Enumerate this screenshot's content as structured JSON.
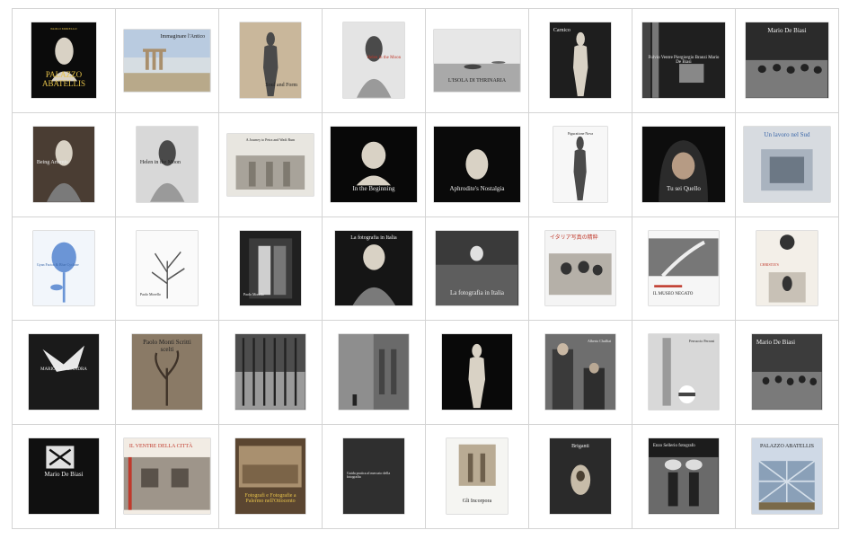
{
  "colors": {
    "grid_line": "#d4d4d4",
    "background": "#ffffff"
  },
  "books": [
    {
      "id": "b01",
      "title": "PALAZZO ABATELLIS",
      "subtitle": "PAOLO MORELLO",
      "bg": "#0b0b0b",
      "fg": "gold",
      "icon": "bust-sculpture-icon",
      "pos": "t-bot",
      "align": "center",
      "tsize": 9,
      "cover": [
        0.18,
        0.13,
        0.64,
        0.73
      ]
    },
    {
      "id": "b02",
      "title": "Immaginare l'Antico",
      "subtitle": "",
      "bg": "#d6dde2",
      "fg": "dark",
      "icon": "ruined-temple-icon",
      "pos": "t-top",
      "align": "right",
      "tsize": 6,
      "cover": [
        0.08,
        0.2,
        0.84,
        0.6
      ]
    },
    {
      "id": "b03",
      "title": "Soul and Form",
      "subtitle": "",
      "bg": "#c9b79b",
      "fg": "dark",
      "icon": "nude-figure-icon",
      "pos": "t-bot",
      "align": "right",
      "tsize": 6,
      "cover": [
        0.2,
        0.13,
        0.6,
        0.73
      ]
    },
    {
      "id": "b04",
      "title": "Helen in the Moon",
      "subtitle": "",
      "bg": "#e4e4e4",
      "fg": "red",
      "icon": "portrait-figure-icon",
      "pos": "t-mid",
      "align": "right",
      "tsize": 5,
      "cover": [
        0.2,
        0.13,
        0.6,
        0.73
      ]
    },
    {
      "id": "b05",
      "title": "L'ISOLA DI THRINARIA",
      "subtitle": "",
      "bg": "#cfcfcf",
      "fg": "dark",
      "icon": "island-seascape-icon",
      "pos": "t-bot",
      "align": "center",
      "tsize": 6,
      "cover": [
        0.08,
        0.2,
        0.84,
        0.6
      ]
    },
    {
      "id": "b06",
      "title": "Carnico",
      "subtitle": "",
      "bg": "#1e1e1e",
      "fg": "light",
      "icon": "nude-figure-icon",
      "pos": "t-top",
      "align": "left",
      "tsize": 6,
      "cover": [
        0.2,
        0.13,
        0.6,
        0.73
      ]
    },
    {
      "id": "b07",
      "title": "Fulvio Ventre Piergiorgio Branzi Mario De Biasi",
      "subtitle": "",
      "bg": "#1f1f1f",
      "fg": "light",
      "icon": "boxed-set-icon",
      "pos": "t-mid",
      "align": "center",
      "tsize": 5,
      "cover": [
        0.1,
        0.13,
        0.8,
        0.73
      ]
    },
    {
      "id": "b08",
      "title": "Mario De Biasi",
      "subtitle": "",
      "bg": "#2b2b2b",
      "fg": "light",
      "icon": "street-crowd-icon",
      "pos": "t-top",
      "align": "center",
      "tsize": 7,
      "cover": [
        0.1,
        0.13,
        0.8,
        0.73
      ]
    },
    {
      "id": "b09",
      "title": "Being Artemis",
      "subtitle": "",
      "bg": "#4a3d33",
      "fg": "light",
      "icon": "portrait-figure-icon",
      "pos": "t-mid",
      "align": "left",
      "tsize": 6,
      "cover": [
        0.2,
        0.13,
        0.6,
        0.73
      ]
    },
    {
      "id": "b10",
      "title": "Helen in the Moon",
      "subtitle": "",
      "bg": "#d8d8d8",
      "fg": "dark",
      "icon": "portrait-figure-icon",
      "pos": "t-mid",
      "align": "left",
      "tsize": 6,
      "cover": [
        0.2,
        0.13,
        0.6,
        0.73
      ]
    },
    {
      "id": "b11",
      "title": "A Journey to Petra and Wadi Rum",
      "subtitle": "",
      "bg": "#e8e6e0",
      "fg": "dark",
      "icon": "rock-temple-icon",
      "pos": "t-top",
      "align": "center",
      "tsize": 4,
      "cover": [
        0.08,
        0.2,
        0.84,
        0.6
      ]
    },
    {
      "id": "b12",
      "title": "In the Beginning",
      "subtitle": "",
      "bg": "#080808",
      "fg": "light",
      "icon": "bust-sculpture-icon",
      "pos": "t-bot",
      "align": "center",
      "tsize": 7,
      "cover": [
        0.08,
        0.13,
        0.84,
        0.73
      ]
    },
    {
      "id": "b13",
      "title": "Aphrodite's Nostalgia",
      "subtitle": "",
      "bg": "#0a0a0a",
      "fg": "light",
      "icon": "shell-figure-icon",
      "pos": "t-bot",
      "align": "center",
      "tsize": 7,
      "cover": [
        0.08,
        0.13,
        0.84,
        0.73
      ]
    },
    {
      "id": "b14",
      "title": "Figuratione Nova",
      "subtitle": "",
      "bg": "#f7f7f7",
      "fg": "dark",
      "icon": "nude-figure-icon",
      "pos": "t-top",
      "align": "center",
      "tsize": 4,
      "cover": [
        0.24,
        0.13,
        0.52,
        0.73
      ]
    },
    {
      "id": "b15",
      "title": "Tu sei Quello",
      "subtitle": "",
      "bg": "#0d0d0d",
      "fg": "light",
      "icon": "hooded-figure-icon",
      "pos": "t-bot",
      "align": "center",
      "tsize": 7,
      "cover": [
        0.1,
        0.13,
        0.8,
        0.73
      ]
    },
    {
      "id": "b16",
      "title": "Un lavoro nel Sud",
      "subtitle": "",
      "bg": "#d7dbe0",
      "fg": "blue",
      "icon": "building-icon",
      "pos": "t-top",
      "align": "center",
      "tsize": 7,
      "cover": [
        0.08,
        0.13,
        0.84,
        0.73
      ]
    },
    {
      "id": "b17",
      "title": "Gyan Factor & Blue Cyclone",
      "subtitle": "",
      "bg": "#f2f6fb",
      "fg": "blue",
      "icon": "flower-icon",
      "pos": "t-mid",
      "align": "left",
      "tsize": 4,
      "cover": [
        0.2,
        0.13,
        0.6,
        0.73
      ]
    },
    {
      "id": "b18",
      "title": "Paolo Morello",
      "subtitle": "",
      "bg": "#fafafa",
      "fg": "dark",
      "icon": "tree-sketch-icon",
      "pos": "t-bot",
      "align": "left",
      "tsize": 4,
      "cover": [
        0.2,
        0.13,
        0.6,
        0.73
      ]
    },
    {
      "id": "b19",
      "title": "Paolo Morello",
      "subtitle": "",
      "bg": "#202020",
      "fg": "light",
      "icon": "doorway-icon",
      "pos": "t-bot",
      "align": "left",
      "tsize": 4,
      "cover": [
        0.2,
        0.13,
        0.6,
        0.73
      ]
    },
    {
      "id": "b20",
      "title": "La fotografia in Italia",
      "subtitle": "",
      "bg": "#151515",
      "fg": "light",
      "icon": "portrait-figure-icon",
      "pos": "t-top",
      "align": "center",
      "tsize": 6,
      "cover": [
        0.12,
        0.13,
        0.76,
        0.73
      ]
    },
    {
      "id": "b21",
      "title": "La fotografia in Italia",
      "subtitle": "",
      "bg": "#3a3a3a",
      "fg": "light",
      "icon": "field-figure-icon",
      "pos": "t-bot",
      "align": "center",
      "tsize": 7,
      "cover": [
        0.1,
        0.13,
        0.8,
        0.73
      ]
    },
    {
      "id": "b22",
      "title": "イタリア写真の精粋",
      "subtitle": "",
      "bg": "#f4f4f4",
      "fg": "red",
      "icon": "group-photo-icon",
      "pos": "t-top",
      "align": "left",
      "tsize": 6,
      "cover": [
        0.16,
        0.13,
        0.68,
        0.73
      ]
    },
    {
      "id": "b23",
      "title": "IL MUSEO NEGATO",
      "subtitle": "",
      "bg": "#f6f6f6",
      "fg": "dark",
      "icon": "landscape-road-icon",
      "pos": "t-bot",
      "align": "left",
      "tsize": 5,
      "cover": [
        0.16,
        0.13,
        0.68,
        0.73
      ]
    },
    {
      "id": "b24",
      "title": "CHRISTIE'S",
      "subtitle": "",
      "bg": "#f3efe8",
      "fg": "red",
      "icon": "child-portrait-icon",
      "pos": "t-mid",
      "align": "left",
      "tsize": 4,
      "cover": [
        0.2,
        0.13,
        0.6,
        0.73
      ]
    },
    {
      "id": "b25",
      "title": "MARIO LASALANDRA",
      "subtitle": "",
      "bg": "#1a1a1a",
      "fg": "light",
      "icon": "glove-hand-icon",
      "pos": "t-mid",
      "align": "center",
      "tsize": 5,
      "cover": [
        0.16,
        0.13,
        0.68,
        0.73
      ]
    },
    {
      "id": "b26",
      "title": "Paolo Monti Scritti scelti",
      "subtitle": "",
      "bg": "#8a7a66",
      "fg": "dark",
      "icon": "leaf-plant-icon",
      "pos": "t-top",
      "align": "center",
      "tsize": 7,
      "cover": [
        0.16,
        0.13,
        0.68,
        0.73
      ]
    },
    {
      "id": "b27",
      "title": "",
      "subtitle": "",
      "bg": "#4d4d4d",
      "fg": "light",
      "icon": "forest-reflection-icon",
      "pos": "t-top",
      "align": "center",
      "tsize": 4,
      "cover": [
        0.16,
        0.13,
        0.68,
        0.73
      ]
    },
    {
      "id": "b28",
      "title": "",
      "subtitle": "",
      "bg": "#8e8e8e",
      "fg": "light",
      "icon": "street-arcade-icon",
      "pos": "t-top",
      "align": "center",
      "tsize": 4,
      "cover": [
        0.16,
        0.13,
        0.68,
        0.73
      ]
    },
    {
      "id": "b29",
      "title": "",
      "subtitle": "",
      "bg": "#090909",
      "fg": "light",
      "icon": "nude-figure-icon",
      "pos": "t-top",
      "align": "center",
      "tsize": 4,
      "cover": [
        0.16,
        0.13,
        0.68,
        0.73
      ]
    },
    {
      "id": "b30",
      "title": "Alberto Chulliat",
      "subtitle": "",
      "bg": "#6e6e6e",
      "fg": "light",
      "icon": "two-men-portrait-icon",
      "pos": "t-top",
      "align": "right",
      "tsize": 4,
      "cover": [
        0.16,
        0.13,
        0.68,
        0.73
      ]
    },
    {
      "id": "b31",
      "title": "Ferruccio Ferroni",
      "subtitle": "",
      "bg": "#cfcfcf",
      "fg": "dark",
      "icon": "beach-ball-icon",
      "pos": "t-top",
      "align": "right",
      "tsize": 4,
      "cover": [
        0.16,
        0.13,
        0.68,
        0.73
      ]
    },
    {
      "id": "b32",
      "title": "Mario De Biasi",
      "subtitle": "",
      "bg": "#3c3c3c",
      "fg": "light",
      "icon": "crowd-icon",
      "pos": "t-top",
      "align": "left",
      "tsize": 7,
      "cover": [
        0.16,
        0.13,
        0.68,
        0.73
      ]
    },
    {
      "id": "b33",
      "title": "Mario De Biasi",
      "subtitle": "",
      "bg": "#101010",
      "fg": "light",
      "icon": "window-light-icon",
      "pos": "t-mid",
      "align": "center",
      "tsize": 7,
      "cover": [
        0.16,
        0.13,
        0.68,
        0.73
      ]
    },
    {
      "id": "b34",
      "title": "IL VENTRE DELLA CITTÀ",
      "subtitle": "",
      "bg": "#f2ece4",
      "fg": "red",
      "icon": "old-street-icon",
      "pos": "t-top",
      "align": "left",
      "tsize": 6,
      "cover": [
        0.08,
        0.13,
        0.84,
        0.73
      ]
    },
    {
      "id": "b35",
      "title": "Fotografi e Fotografie a Palermo nell'Ottocento",
      "subtitle": "",
      "bg": "#5b4631",
      "fg": "gold",
      "icon": "old-city-icon",
      "pos": "t-bot",
      "align": "center",
      "tsize": 6,
      "cover": [
        0.16,
        0.13,
        0.68,
        0.73
      ]
    },
    {
      "id": "b36",
      "title": "Guida pratica al mercato della fotografia",
      "subtitle": "",
      "bg": "#2f2f2f",
      "fg": "light",
      "icon": "",
      "pos": "t-mid",
      "align": "left",
      "tsize": 4,
      "cover": [
        0.2,
        0.13,
        0.6,
        0.73
      ]
    },
    {
      "id": "b37",
      "title": "Gli Incorpora",
      "subtitle": "",
      "bg": "#f5f5f2",
      "fg": "dark",
      "icon": "antique-photo-icon",
      "pos": "t-bot",
      "align": "center",
      "tsize": 6,
      "cover": [
        0.2,
        0.13,
        0.6,
        0.73
      ]
    },
    {
      "id": "b38",
      "title": "Briganti",
      "subtitle": "",
      "bg": "#2a2a2a",
      "fg": "light",
      "icon": "oval-portrait-icon",
      "pos": "t-top",
      "align": "center",
      "tsize": 6,
      "cover": [
        0.2,
        0.13,
        0.6,
        0.73
      ]
    },
    {
      "id": "b39",
      "title": "Enzo Sellerio fotografo",
      "subtitle": "",
      "bg": "#1c1c1c",
      "fg": "light",
      "icon": "children-basket-icon",
      "pos": "t-top",
      "align": "left",
      "tsize": 5,
      "cover": [
        0.16,
        0.13,
        0.68,
        0.73
      ]
    },
    {
      "id": "b40",
      "title": "PALAZZO ABATELLIS",
      "subtitle": "",
      "bg": "#cfd9e6",
      "fg": "dark",
      "icon": "courtyard-icon",
      "pos": "t-top",
      "align": "center",
      "tsize": 6,
      "cover": [
        0.16,
        0.13,
        0.68,
        0.73
      ]
    }
  ]
}
